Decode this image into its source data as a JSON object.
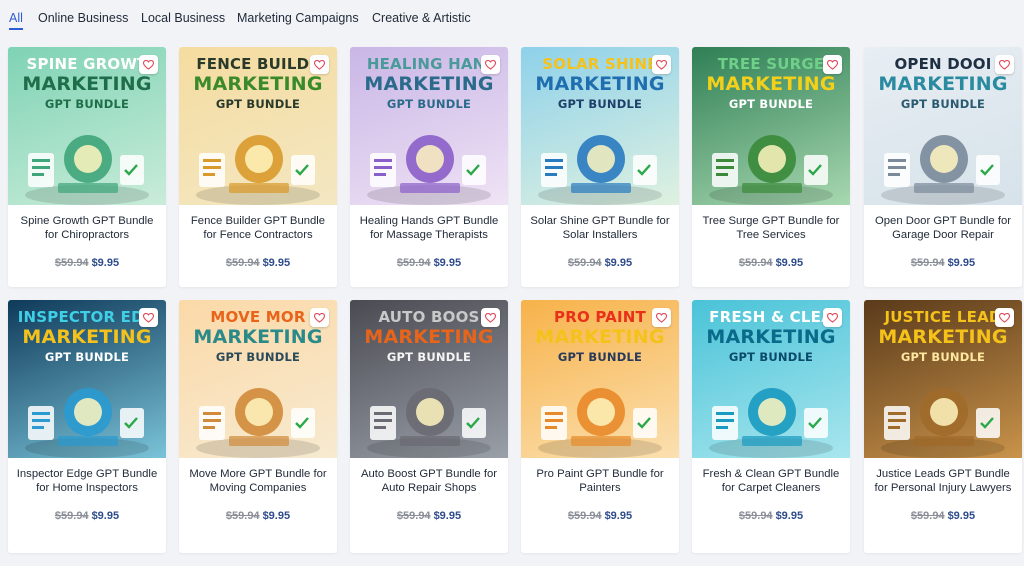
{
  "tabs": [
    {
      "label": "All",
      "active": true
    },
    {
      "label": "Online Business",
      "active": false
    },
    {
      "label": "Local Business",
      "active": false
    },
    {
      "label": "Marketing Campaigns",
      "active": false
    },
    {
      "label": "Creative & Artistic",
      "active": false
    }
  ],
  "products": [
    {
      "thumb_line1": "SPINE GROWT",
      "thumb_line2": "MARKETING",
      "thumb_line3": "GPT BUNDLE",
      "title": "Spine Growth GPT Bundle for Chiropractors",
      "old_price": "$59.94",
      "price": "$9.95",
      "bg": [
        "#7fd3b5",
        "#c9ecd9"
      ],
      "c1": "#ffffff",
      "c2": "#1f6e4a",
      "c3": "#1f6e4a",
      "art": "#3fa57a"
    },
    {
      "thumb_line1": "FENCE BUILDE",
      "thumb_line2": "MARKETING",
      "thumb_line3": "GPT BUNDLE",
      "title": "Fence Builder GPT Bundle for Fence Contractors",
      "old_price": "$59.94",
      "price": "$9.95",
      "bg": [
        "#f5dca0",
        "#f3e7c2"
      ],
      "c1": "#2a3a2a",
      "c2": "#3a8a2a",
      "c3": "#2a3a2a",
      "art": "#d99a2b"
    },
    {
      "thumb_line1": "HEALING HANI",
      "thumb_line2": "MARKETING",
      "thumb_line3": "GPT BUNDLE",
      "title": "Healing Hands GPT Bundle for Massage Therapists",
      "old_price": "$59.94",
      "price": "$9.95",
      "bg": [
        "#c9b6e6",
        "#efe3f5"
      ],
      "c1": "#4a9a9a",
      "c2": "#2a6a8a",
      "c3": "#2a6a8a",
      "art": "#8b5fc9"
    },
    {
      "thumb_line1": "SOLAR SHINE",
      "thumb_line2": "MARKETING",
      "thumb_line3": "GPT BUNDLE",
      "title": "Solar Shine GPT Bundle for Solar Installers",
      "old_price": "$59.94",
      "price": "$9.95",
      "bg": [
        "#8ed1ea",
        "#dff1e0"
      ],
      "c1": "#f4c21a",
      "c2": "#1f6fb0",
      "c3": "#1f3f6a",
      "art": "#2a7ac0"
    },
    {
      "thumb_line1": "TREE SURGE",
      "thumb_line2": "MARKETING",
      "thumb_line3": "GPT BUNDLE",
      "title": "Tree Surge GPT Bundle for Tree Services",
      "old_price": "$59.94",
      "price": "$9.95",
      "bg": [
        "#2f7f55",
        "#a8d8b0"
      ],
      "c1": "#6fd08a",
      "c2": "#f4d01a",
      "c3": "#ffffff",
      "art": "#3a8a3a"
    },
    {
      "thumb_line1": "OPEN DOOI",
      "thumb_line2": "MARKETING",
      "thumb_line3": "GPT BUNDLE",
      "title": "Open Door GPT Bundle for Garage Door Repair",
      "old_price": "$59.94",
      "price": "$9.95",
      "bg": [
        "#e8eef3",
        "#d6e2ea"
      ],
      "c1": "#1f2f44",
      "c2": "#2a8aa0",
      "c3": "#2a5a70",
      "art": "#7a8a9a"
    },
    {
      "thumb_line1": "INSPECTOR EDG",
      "thumb_line2": "MARKETING",
      "thumb_line3": "GPT BUNDLE",
      "title": "Inspector Edge GPT Bundle for Home Inspectors",
      "old_price": "$59.94",
      "price": "$9.95",
      "bg": [
        "#0f3a5a",
        "#7ac3d8"
      ],
      "c1": "#3fd0e8",
      "c2": "#f4c21a",
      "c3": "#ffffff",
      "art": "#2a9ad0"
    },
    {
      "thumb_line1": "MOVE MOR",
      "thumb_line2": "MARKETING",
      "thumb_line3": "GPT BUNDLE",
      "title": "Move More GPT Bundle for Moving Companies",
      "old_price": "$59.94",
      "price": "$9.95",
      "bg": [
        "#fbd9a8",
        "#f7ead0"
      ],
      "c1": "#e8641a",
      "c2": "#2a8a8a",
      "c3": "#2a4a5a",
      "art": "#d08a3a"
    },
    {
      "thumb_line1": "AUTO BOOS",
      "thumb_line2": "MARKETING",
      "thumb_line3": "GPT BUNDLE",
      "title": "Auto Boost GPT Bundle for Auto Repair Shops",
      "old_price": "$59.94",
      "price": "$9.95",
      "bg": [
        "#4a4a52",
        "#9aa0a8"
      ],
      "c1": "#c9c9c9",
      "c2": "#e8641a",
      "c3": "#f4f4f4",
      "art": "#6a6a72"
    },
    {
      "thumb_line1": "PRO PAINT",
      "thumb_line2": "MARKETING",
      "thumb_line3": "GPT BUNDLE",
      "title": "Pro Paint GPT Bundle for Painters",
      "old_price": "$59.94",
      "price": "$9.95",
      "bg": [
        "#f7b24a",
        "#fbe0b0"
      ],
      "c1": "#e8301a",
      "c2": "#f4c21a",
      "c3": "#2a3a5a",
      "art": "#e88a2a"
    },
    {
      "thumb_line1": "FRESH & CLEA",
      "thumb_line2": "MARKETING",
      "thumb_line3": "GPT BUNDLE",
      "title": "Fresh & Clean GPT Bundle for Carpet Cleaners",
      "old_price": "$59.94",
      "price": "$9.95",
      "bg": [
        "#4ac3d8",
        "#a8e6ee"
      ],
      "c1": "#ffffff",
      "c2": "#0a6a8a",
      "c3": "#0a4a6a",
      "art": "#1a9ac0"
    },
    {
      "thumb_line1": "JUSTICE LEAD",
      "thumb_line2": "MARKETING",
      "thumb_line3": "GPT BUNDLE",
      "title": "Justice Leads GPT Bundle for Personal Injury Lawyers",
      "old_price": "$59.94",
      "price": "$9.95",
      "bg": [
        "#5a3a1a",
        "#c9934a"
      ],
      "c1": "#f4c21a",
      "c2": "#f4c21a",
      "c3": "#ffe7a0",
      "art": "#a06a2a"
    }
  ]
}
